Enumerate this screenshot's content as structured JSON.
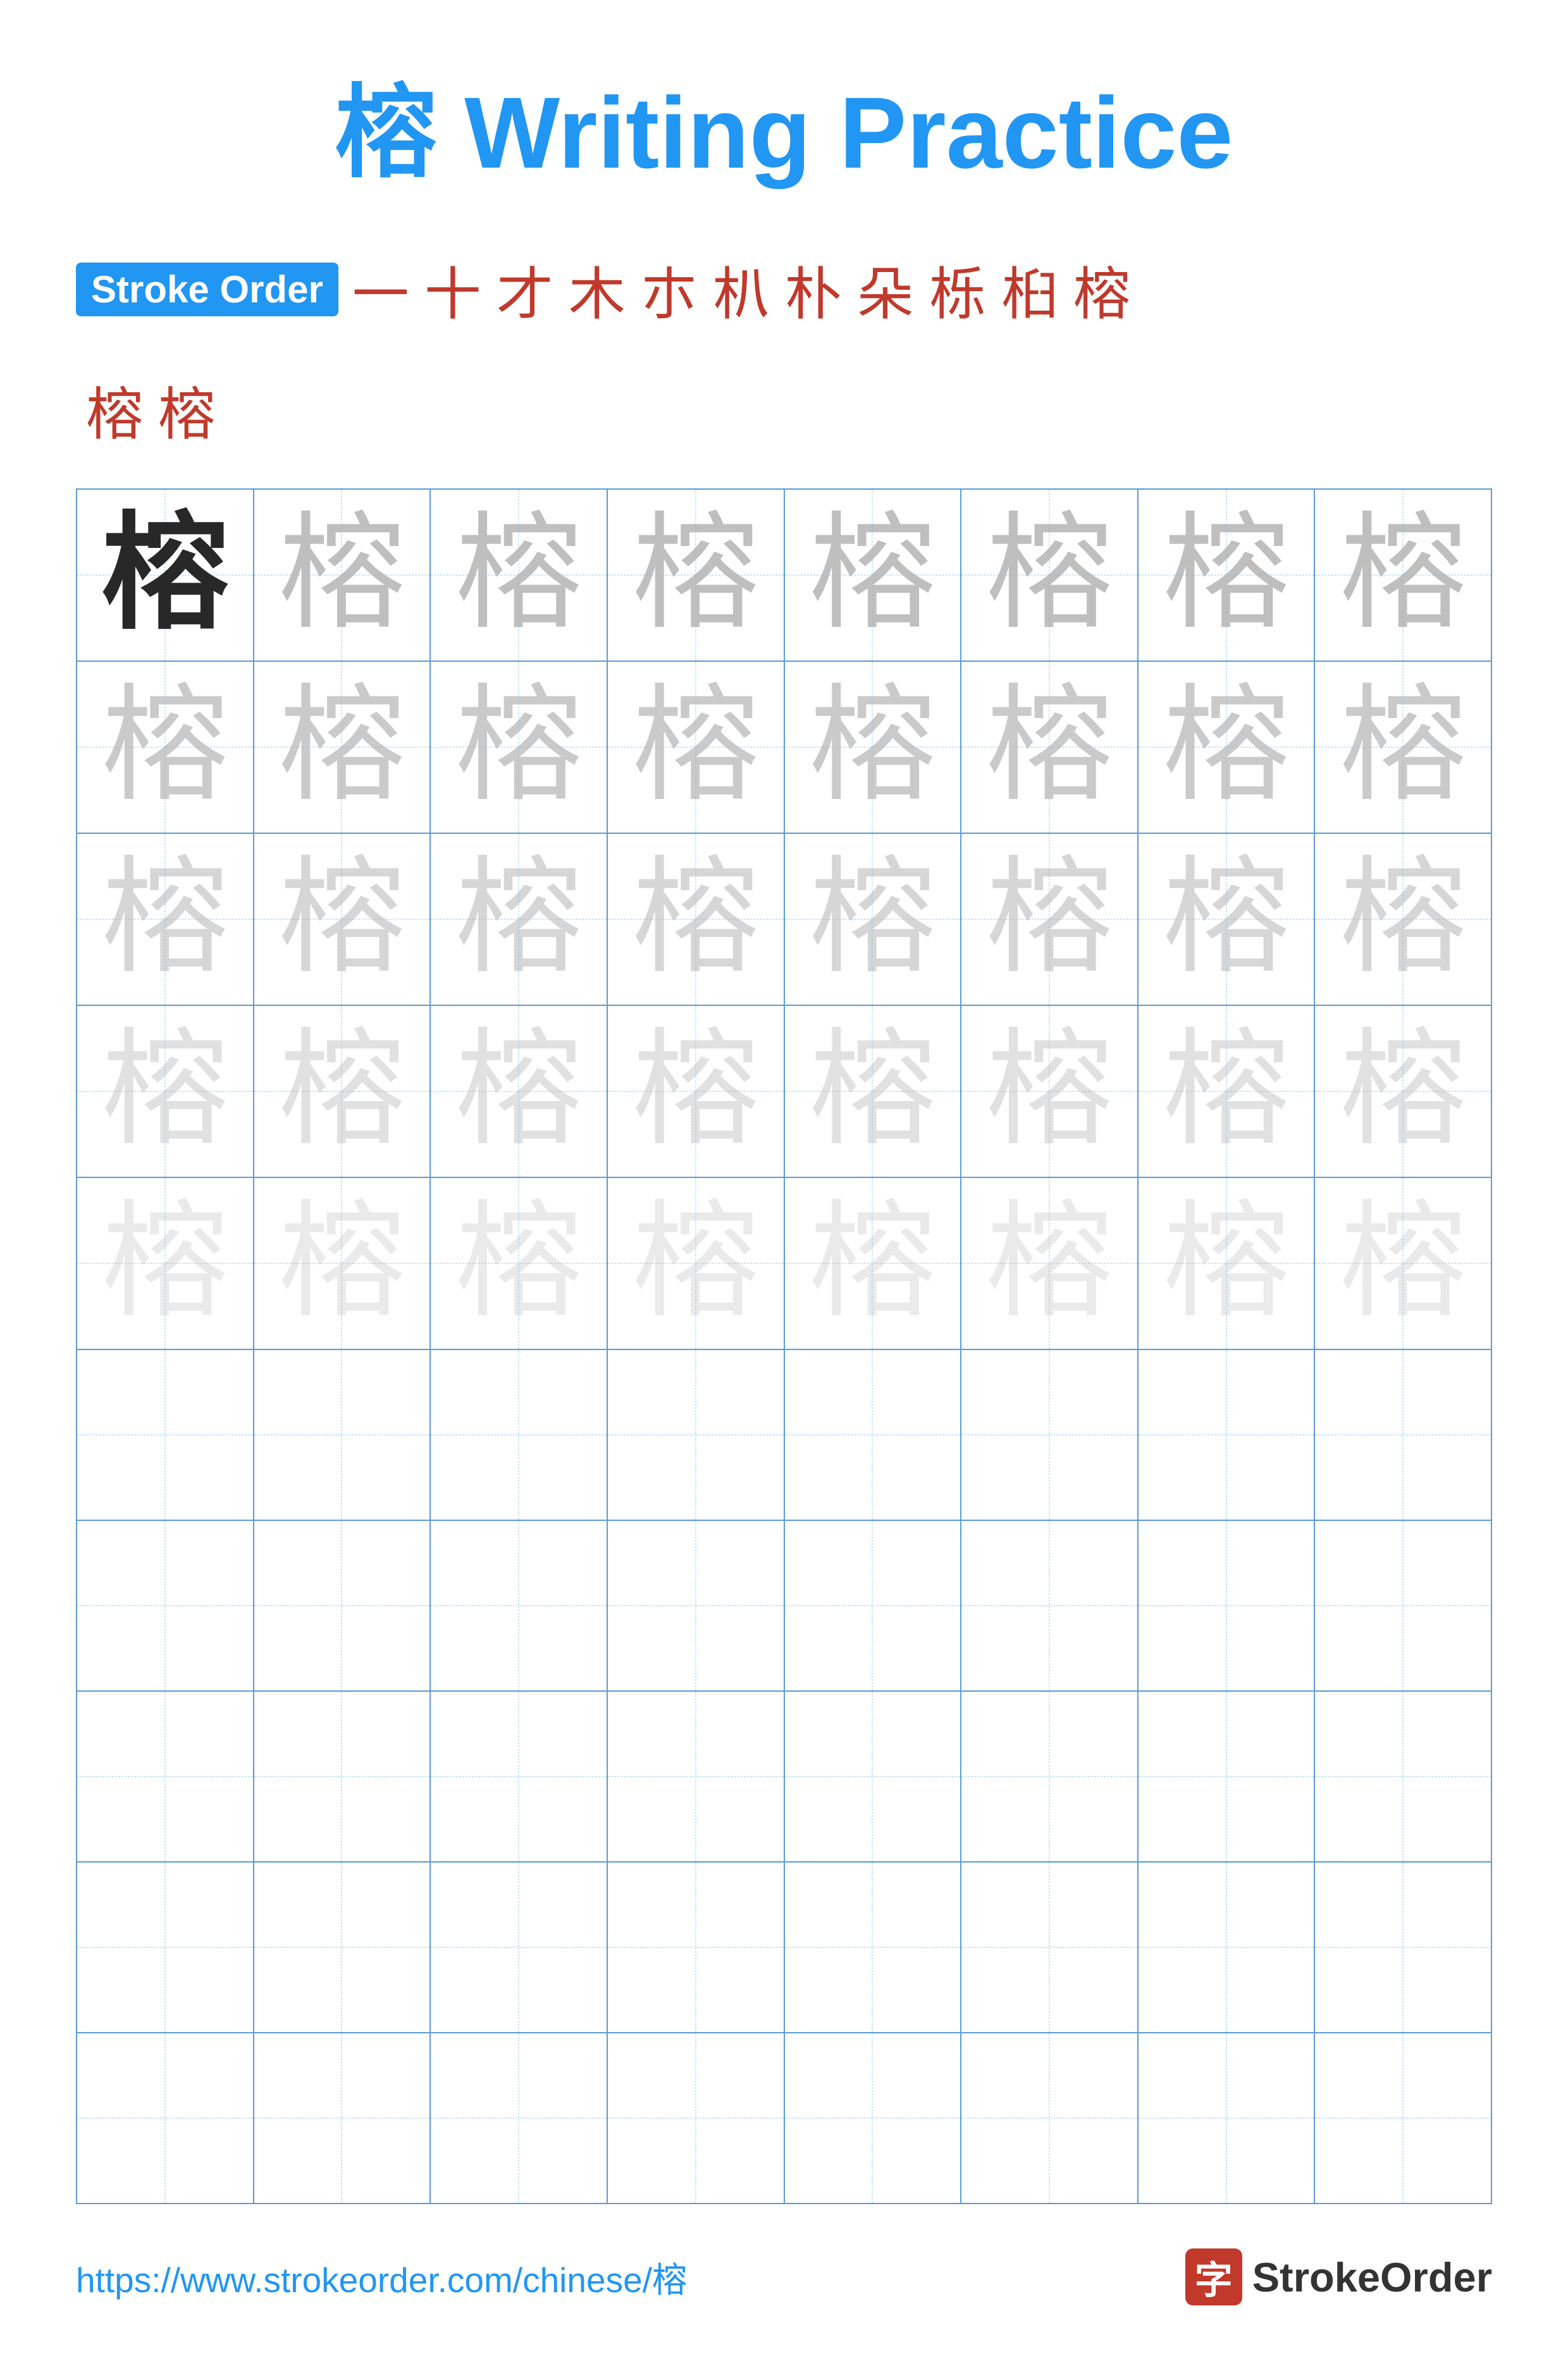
{
  "title": {
    "char": "榕",
    "text": " Writing Practice",
    "full": "榕 Writing Practice"
  },
  "stroke_order": {
    "badge_label": "Stroke Order",
    "strokes_line1": [
      "一",
      "十",
      "才",
      "木",
      "朩",
      "朳",
      "朴",
      "朵",
      "栎",
      "桕",
      "榕"
    ],
    "strokes_line2": [
      "榕",
      "榕"
    ]
  },
  "practice": {
    "character": "榕",
    "rows": 10,
    "cols": 8,
    "guide_color": "#90CAF9",
    "border_color": "#5B9BD5"
  },
  "footer": {
    "url": "https://www.strokeorder.com/chinese/榕",
    "brand_char": "字",
    "brand_name": "StrokeOrder"
  }
}
